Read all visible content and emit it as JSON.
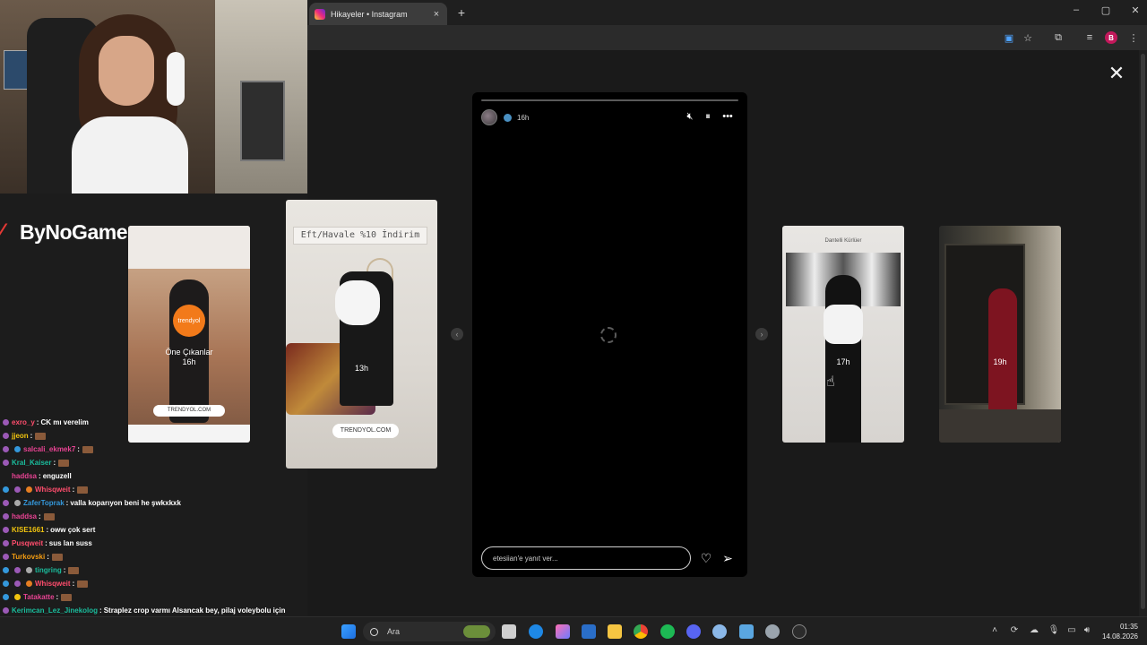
{
  "browser": {
    "tab_title": "Hikayeler • Instagram",
    "tab_close": "×",
    "new_tab": "+",
    "window": {
      "minimize": "–",
      "maximize": "▢",
      "close": "✕"
    },
    "profile_letter": "B"
  },
  "overlay": {
    "logo_text": "ByNoGame"
  },
  "story": {
    "time": "16h",
    "progress": 0.0,
    "reply_placeholder": "etesiian'e yanıt ver...",
    "close": "✕"
  },
  "cards": [
    {
      "name": "Öne Çıkanlar",
      "time": "16h",
      "ring_label": "trendyol",
      "link": "TRENDYOL.COM",
      "top_text": "Trendyol"
    },
    {
      "time": "13h",
      "banner": "Eft/Havale %10 İndirim",
      "link": "TRENDYOL.COM"
    },
    {
      "time": "17h",
      "banner": "Dantelli Kürlüer"
    },
    {
      "time": "19h"
    }
  ],
  "chat": [
    {
      "user": "exro_y",
      "user_color": "#ff4d6d",
      "msg": "CK mı verelim",
      "emote": false,
      "badges": [
        "#9b59b6"
      ]
    },
    {
      "user": "jjeon",
      "user_color": "#f1c40f",
      "msg": "",
      "emote": true,
      "badges": [
        "#9b59b6"
      ]
    },
    {
      "user": "salcali_ekmek7",
      "user_color": "#e84393",
      "msg": "",
      "emote": true,
      "badges": [
        "#9b59b6",
        "#3498db"
      ]
    },
    {
      "user": "Kral_Kaiser",
      "user_color": "#1abc9c",
      "msg": "",
      "emote": true,
      "badges": [
        "#9b59b6"
      ]
    },
    {
      "user": "haddsa",
      "user_color": "#e84393",
      "msg": "enguzell",
      "emote": false,
      "badges": []
    },
    {
      "user": "Whisqweit",
      "user_color": "#ff4d6d",
      "msg": "",
      "emote": true,
      "badges": [
        "#3498db",
        "#9b59b6",
        "#e67e22"
      ]
    },
    {
      "user": "ZaferToprak",
      "user_color": "#3498db",
      "msg": "valla koparıyon beni he şwkxkxk",
      "emote": false,
      "badges": [
        "#9b59b6",
        "#aaa"
      ]
    },
    {
      "user": "haddsa",
      "user_color": "#e84393",
      "msg": "",
      "emote": true,
      "badges": [
        "#9b59b6"
      ]
    },
    {
      "user": "KISE1661",
      "user_color": "#f1c40f",
      "msg": "oww çok sert",
      "emote": false,
      "badges": [
        "#9b59b6"
      ]
    },
    {
      "user": "Pusqweit",
      "user_color": "#ff4d6d",
      "msg": "sus lan suss",
      "emote": false,
      "badges": [
        "#9b59b6"
      ]
    },
    {
      "user": "Turkovski",
      "user_color": "#f39c12",
      "msg": "",
      "emote": true,
      "badges": [
        "#9b59b6"
      ]
    },
    {
      "user": "tingring",
      "user_color": "#1abc9c",
      "msg": "",
      "emote": true,
      "badges": [
        "#3498db",
        "#9b59b6",
        "#aaa"
      ]
    },
    {
      "user": "Whisqweit",
      "user_color": "#ff4d6d",
      "msg": "",
      "emote": true,
      "badges": [
        "#3498db",
        "#9b59b6",
        "#e67e22"
      ]
    },
    {
      "user": "Tatakatte",
      "user_color": "#e84393",
      "msg": "",
      "emote": true,
      "badges": [
        "#3498db",
        "#f1c40f"
      ]
    },
    {
      "user": "Kerimcan_Lez_Jinekolog",
      "user_color": "#1abc9c",
      "msg": "Straplez crop varmı Alsancak bey, pilaj voleybolu için",
      "emote": false,
      "badges": [
        "#9b59b6"
      ]
    }
  ],
  "taskbar": {
    "search_placeholder": "Ara",
    "time": "01:35",
    "date": "14.08.2026"
  }
}
